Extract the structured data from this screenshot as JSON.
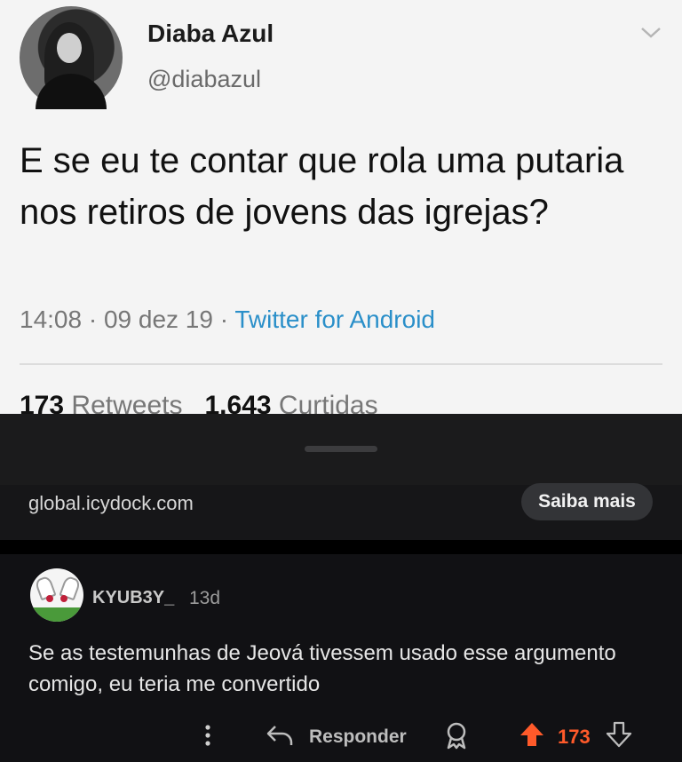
{
  "tweet": {
    "author_name": "Diaba Azul",
    "author_handle": "@diabazul",
    "text": "E se eu te contar que rola uma putaria nos retiros de jovens das igrejas?",
    "meta_time": "14:08 · 09 dez 19 · ",
    "meta_source": "Twitter for Android",
    "retweets_count": "173",
    "retweets_label": "Retweets",
    "likes_count": "1.643",
    "likes_label": "Curtidas"
  },
  "ad": {
    "url": "global.icydock.com",
    "cta_label": "Saiba mais"
  },
  "comment": {
    "username": "KYUB3Y_",
    "age": "13d",
    "body": "Se as testemunhas de Jeová tivessem usado esse argumento comigo, eu teria me convertido",
    "reply_label": "Responder",
    "score": "173"
  },
  "colors": {
    "upvote_accent": "#ff5a2a",
    "tweet_source_link": "#2a8fc9"
  },
  "icons": [
    "chevron-down-icon",
    "kebab-menu-icon",
    "reply-arrow-icon",
    "award-icon",
    "upvote-icon",
    "downvote-icon"
  ]
}
